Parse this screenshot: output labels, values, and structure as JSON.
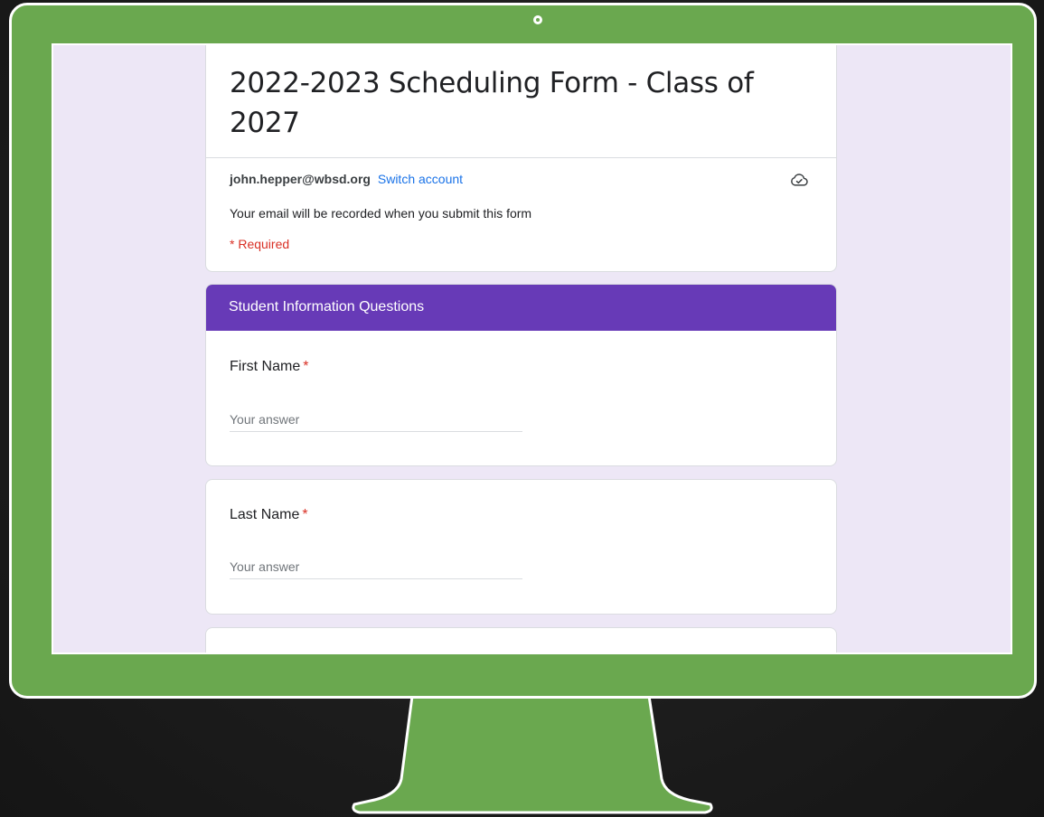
{
  "form": {
    "title": "2022-2023 Scheduling Form - Class of 2027",
    "account_email": "john.hepper@wbsd.org",
    "switch_account_label": "Switch account",
    "record_note": "Your email will be recorded when you submit this form",
    "required_note": "* Required"
  },
  "section": {
    "title": "Student Information Questions"
  },
  "questions": [
    {
      "label": "First Name",
      "required_mark": "*",
      "placeholder": "Your answer"
    },
    {
      "label": "Last Name",
      "required_mark": "*",
      "placeholder": "Your answer"
    }
  ],
  "colors": {
    "bezel": "#6aa84f",
    "screen_background": "#ede7f6",
    "section_header": "#673ab7",
    "link": "#1a73e8",
    "required": "#d93025"
  },
  "icons": {
    "cloud": "cloud-check-icon",
    "camera": "camera-dot-icon"
  }
}
